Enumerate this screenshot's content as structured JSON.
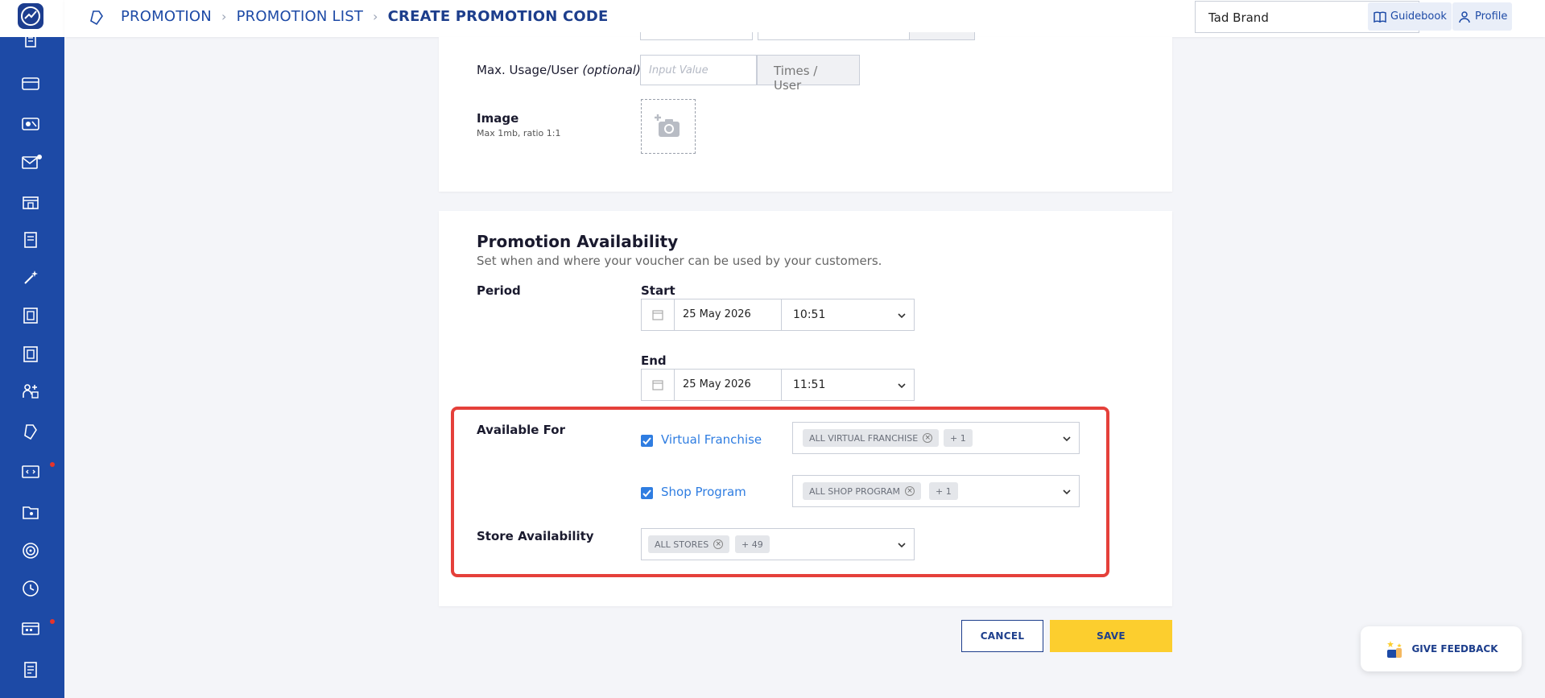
{
  "header": {
    "breadcrumb": [
      "PROMOTION",
      "PROMOTION LIST",
      "CREATE PROMOTION CODE"
    ],
    "brand_selected": "Tad Brand",
    "guidebook_label": "Guidebook",
    "profile_label": "Profile"
  },
  "details": {
    "max_usage_label": "Max. Usage/User",
    "optional_label": "(optional)",
    "max_usage_placeholder": "Input Value",
    "max_usage_suffix": "Times / User",
    "image_label": "Image",
    "image_hint": "Max 1mb, ratio 1:1"
  },
  "availability": {
    "title": "Promotion Availability",
    "description": "Set when and where your voucher can be used by your customers.",
    "period_label": "Period",
    "start_label": "Start",
    "start_date": "25 May 2026",
    "start_time": "10:51",
    "end_label": "End",
    "end_date": "25 May 2026",
    "end_time": "11:51",
    "available_for_label": "Available For",
    "virtual_franchise_label": "Virtual Franchise",
    "virtual_franchise_tag": "ALL VIRTUAL FRANCHISE",
    "virtual_franchise_more": "+ 1",
    "shop_program_label": "Shop Program",
    "shop_program_tag": "ALL SHOP PROGRAM",
    "shop_program_more": "+ 1",
    "store_availability_label": "Store Availability",
    "stores_tag": "ALL STORES",
    "stores_more": "+ 49"
  },
  "actions": {
    "cancel_label": "CANCEL",
    "save_label": "SAVE",
    "feedback_label": "GIVE FEEDBACK"
  },
  "colors": {
    "sidebar": "#1d4aa6",
    "accent": "#2f7de1",
    "save": "#fcce2e",
    "highlight": "#e5403a"
  }
}
